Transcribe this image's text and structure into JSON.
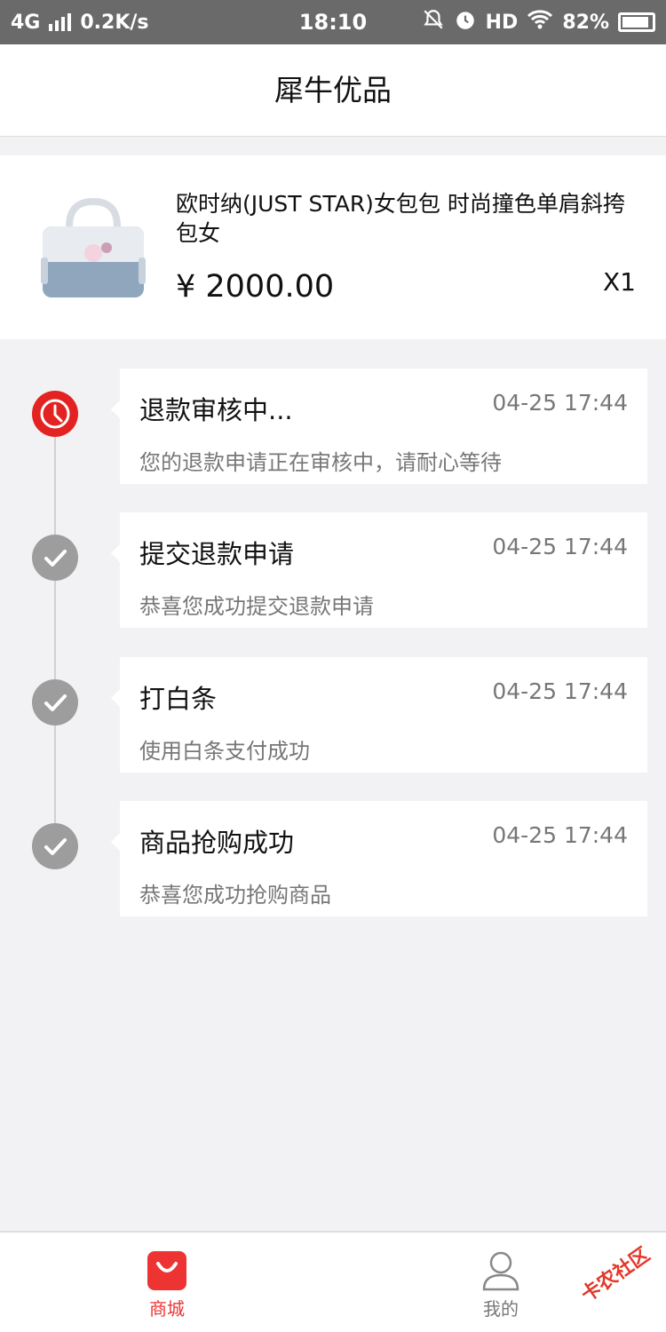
{
  "status_bar": {
    "network": "4G",
    "speed": "0.2K/s",
    "time": "18:10",
    "hd": "HD",
    "battery": "82%"
  },
  "header": {
    "title": "犀牛优品"
  },
  "product": {
    "name": "欧时纳(JUST STAR)女包包 时尚撞色单肩斜挎包女",
    "price": "¥ 2000.00",
    "quantity": "X1",
    "image_icon": "handbag-image"
  },
  "timeline": [
    {
      "title": "退款审核中...",
      "time": "04-25 17:44",
      "desc": "您的退款申请正在审核中，请耐心等待",
      "icon": "clock-icon",
      "state": "active",
      "color": "#e32222"
    },
    {
      "title": "提交退款申请",
      "time": "04-25 17:44",
      "desc": "恭喜您成功提交退款申请",
      "icon": "check-icon",
      "state": "done",
      "color": "#9d9d9d"
    },
    {
      "title": "打白条",
      "time": "04-25 17:44",
      "desc": "使用白条支付成功",
      "icon": "check-icon",
      "state": "done",
      "color": "#9d9d9d"
    },
    {
      "title": "商品抢购成功",
      "time": "04-25 17:44",
      "desc": "恭喜您成功抢购商品",
      "icon": "check-icon",
      "state": "done",
      "color": "#9d9d9d"
    }
  ],
  "bottom_nav": {
    "items": [
      {
        "label": "商城",
        "icon": "shopping-bag-icon",
        "active": true
      },
      {
        "label": "我的",
        "icon": "user-icon",
        "active": false
      }
    ]
  },
  "watermark": "卡农社区",
  "colors": {
    "accent": "#e32222",
    "status_bar_bg": "#6a6a6a",
    "page_bg": "#f2f2f5"
  }
}
